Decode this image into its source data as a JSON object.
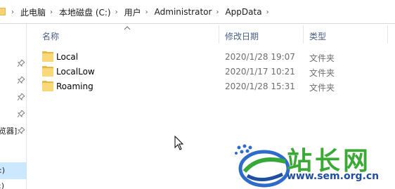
{
  "address_bar": {
    "crumbs": [
      "此电脑",
      "本地磁盘 (C:)",
      "用户",
      "Administrator",
      "AppData"
    ]
  },
  "columns": {
    "name": "名称",
    "modified": "修改日期",
    "type": "类型"
  },
  "rows": [
    {
      "name": "Local",
      "modified": "2020/1/28 19:07",
      "type": "文件夹"
    },
    {
      "name": "LocalLow",
      "modified": "2020/1/17 10:21",
      "type": "文件夹"
    },
    {
      "name": "Roaming",
      "modified": "2020/1/28 15:31",
      "type": "文件夹"
    }
  ],
  "nav": {
    "partial_item": "览器]",
    "drive_label": ":)",
    "drive_label_2": ":)"
  },
  "watermark": {
    "text": "站长网",
    "url": "www.sem.org.cn"
  }
}
